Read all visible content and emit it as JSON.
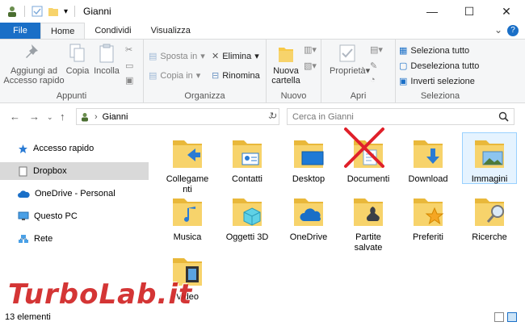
{
  "window": {
    "title": "Gianni",
    "controls": {
      "minimize": "—",
      "maximize": "☐",
      "close": "✕"
    }
  },
  "tabs": [
    {
      "label": "File"
    },
    {
      "label": "Home"
    },
    {
      "label": "Condividi"
    },
    {
      "label": "Visualizza"
    }
  ],
  "ribbon": {
    "appunti": {
      "group_label": "Appunti",
      "pin_label_1": "Aggiungi ad",
      "pin_label_2": "Accesso rapido",
      "copy_label": "Copia",
      "paste_label": "Incolla"
    },
    "organizza": {
      "group_label": "Organizza",
      "move_label": "Sposta in",
      "copyto_label": "Copia in",
      "delete_label": "Elimina",
      "rename_label": "Rinomina"
    },
    "nuovo": {
      "group_label": "Nuovo",
      "newfolder_label_1": "Nuova",
      "newfolder_label_2": "cartella"
    },
    "apri": {
      "group_label": "Apri",
      "properties_label": "Proprietà"
    },
    "seleziona": {
      "group_label": "Seleziona",
      "select_all": "Seleziona tutto",
      "deselect_all": "Deseleziona tutto",
      "invert": "Inverti selezione"
    }
  },
  "address": {
    "path": "Gianni",
    "search_placeholder": "Cerca in Gianni"
  },
  "nav": {
    "items": [
      {
        "label": "Accesso rapido"
      },
      {
        "label": "Dropbox"
      },
      {
        "label": "OneDrive - Personal"
      },
      {
        "label": "Questo PC"
      },
      {
        "label": "Rete"
      }
    ]
  },
  "folders": [
    {
      "label": "Collegame\nnti"
    },
    {
      "label": "Contatti"
    },
    {
      "label": "Desktop"
    },
    {
      "label": "Documenti"
    },
    {
      "label": "Download"
    },
    {
      "label": "Immagini"
    },
    {
      "label": "Musica"
    },
    {
      "label": "Oggetti 3D"
    },
    {
      "label": "OneDrive"
    },
    {
      "label": "Partite\nsalvate"
    },
    {
      "label": "Preferiti"
    },
    {
      "label": "Ricerche"
    },
    {
      "label": "Video"
    }
  ],
  "status": {
    "count": "13 elementi"
  },
  "watermark": "TurboLab.it",
  "colors": {
    "accent": "#1a6fc7",
    "folder": "#f7d36b",
    "cross": "#e0202a"
  }
}
